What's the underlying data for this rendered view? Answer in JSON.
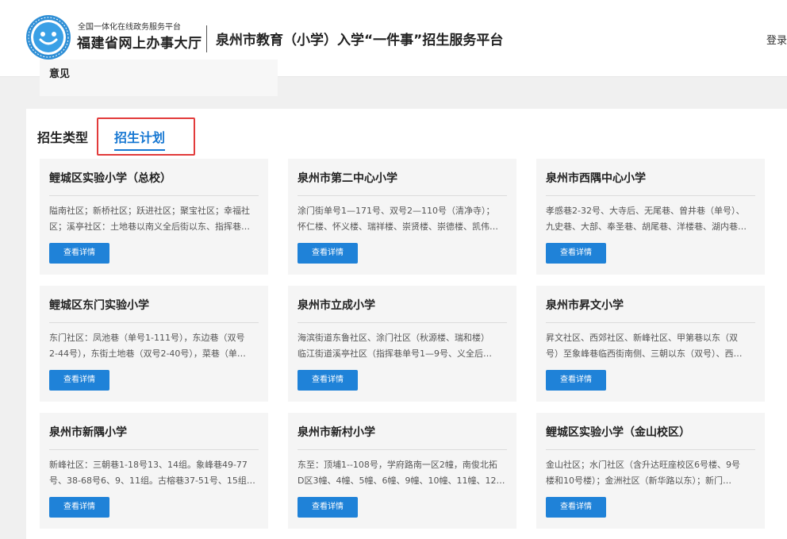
{
  "header": {
    "brand_sub": "全国一体化在线政务服务平台",
    "brand_main": "福建省网上办事大厅",
    "platform_title": "泉州市教育（小学）入学“一件事”招生服务平台",
    "login": "登录",
    "logo_icon": "smiley-seal-logo"
  },
  "top_card": {
    "label": "意见"
  },
  "tabs": {
    "type_label": "招生类型",
    "plan_label": "招生计划",
    "active": "招生计划",
    "highlight_color": "#e23b3b",
    "active_color": "#1677d2"
  },
  "schools": [
    {
      "name": "鲤城区实验小学（总校）",
      "desc": "隘南社区；新桥社区；跃进社区；聚宝社区；幸福社\n区；溪亭社区：土地巷以南义全后街以东、指挥巷…",
      "button": "查看详情"
    },
    {
      "name": "泉州市第二中心小学",
      "desc": "涂门街单号1—171号、双号2—110号（清净寺）；\n怀仁楼、怀义楼、瑞祥楼、崇贤楼、崇德楼、凯伟…",
      "button": "查看详情"
    },
    {
      "name": "泉州市西隅中心小学",
      "desc": "孝感巷2-32号、大寺后、无尾巷、曾井巷（单号）、\n九史巷、大部、奉圣巷、胡尾巷、洋楼巷、湖内巷…",
      "button": "查看详情"
    },
    {
      "name": "鲤城区东门实验小学",
      "desc": "东门社区：凤池巷（单号1-111号），东边巷（双号\n2-44号），东街土地巷（双号2-40号），菜巷（单…",
      "button": "查看详情"
    },
    {
      "name": "泉州市立成小学",
      "desc": "海滨街道东鲁社区、涂门社区（秋源楼、瑞和楼）\n临江街道溪亭社区（指挥巷单号1—9号、义全后…",
      "button": "查看详情"
    },
    {
      "name": "泉州市昇文小学",
      "desc": "昇文社区、西郊社区、新峰社区、甲第巷以东（双\n号）至象峰巷临西街南侧、三朝以东（双号）、西…",
      "button": "查看详情"
    },
    {
      "name": "泉州市新隅小学",
      "desc": "新峰社区：三朝巷1-18号13、14组。象峰巷49-77\n号、38-68号6、9、11组。古榕巷37-51号、15组…",
      "button": "查看详情"
    },
    {
      "name": "泉州市新村小学",
      "desc": "东至：顶埔1--108号，学府路南一区2幢，南俊北拓\nD区3幢、4幢、5幢、6幢、9幢、10幢、11幢、12…",
      "button": "查看详情"
    },
    {
      "name": "鲤城区实验小学（金山校区）",
      "desc": "金山社区；水门社区（含升达旺座校区6号楼、9号\n楼和10号楼）；金洲社区（新华路以东）；新门…",
      "button": "查看详情"
    }
  ],
  "colors": {
    "button_bg": "#1f82d8",
    "card_bg": "#f5f5f5"
  }
}
